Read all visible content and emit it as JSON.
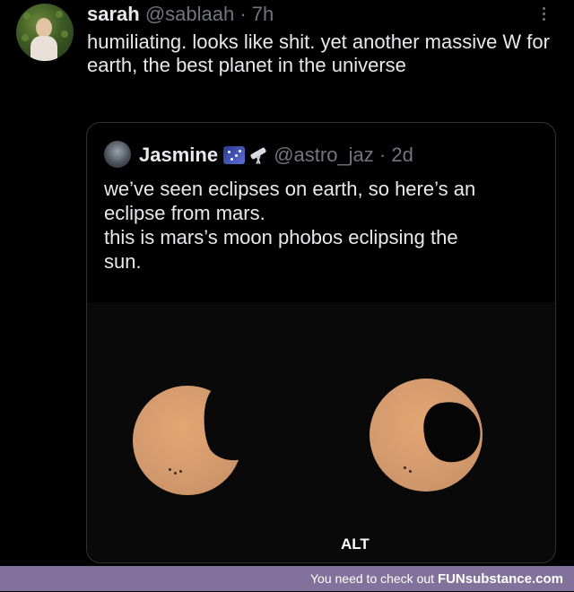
{
  "tweet": {
    "author_name": "sarah",
    "author_meta": "@sablaah · 7h",
    "text": "humiliating. looks like shit. yet another massive W for earth, the best planet in the universe"
  },
  "quote": {
    "author_name": "Jasmine",
    "author_meta": "@astro_jaz · 2d",
    "text_lines": [
      "we’ve seen eclipses on earth, so here’s an",
      "eclipse from mars.",
      "this is mars’s moon phobos eclipsing the",
      "sun."
    ],
    "alt_label": "ALT"
  },
  "footer": {
    "message": "You need to check out ",
    "brand": "FUNsubstance.com"
  },
  "colors": {
    "background": "#000000",
    "text": "#e7e9ea",
    "muted": "#71767b",
    "border": "#2f3336",
    "footer": "#82729b",
    "sun": "#d39a6e"
  },
  "icons": [
    "more-icon",
    "galaxy-emoji-icon",
    "telescope-emoji-icon"
  ]
}
